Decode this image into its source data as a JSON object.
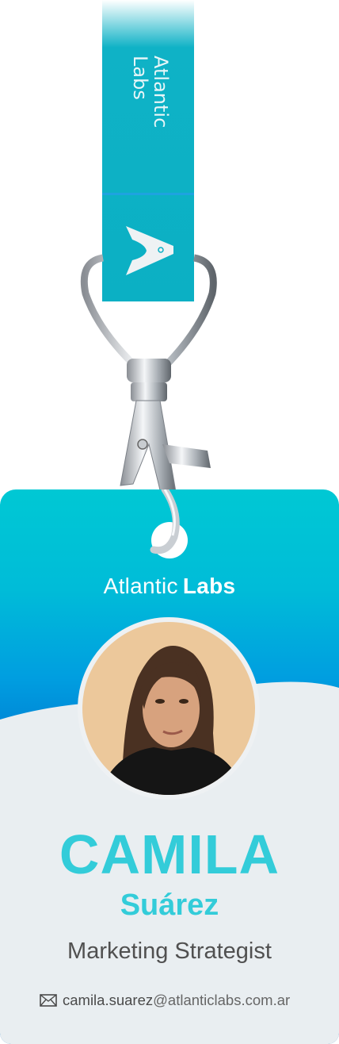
{
  "lanyard": {
    "text_line1": "Atlantic",
    "text_line2": "Labs",
    "logo_icon": "atlantic-labs-rocket-a-logo",
    "color": "#0fb2c6"
  },
  "card": {
    "brand": {
      "part1": "Atlantic",
      "part2": "Labs"
    },
    "first_name": "CAMILA",
    "last_name": "Suárez",
    "role": "Marketing Strategist",
    "email": {
      "icon": "envelope-icon",
      "user": "camila.suarez",
      "domain": "@atlanticlabs.com.ar"
    },
    "colors": {
      "gradient_top": "#00c8d4",
      "gradient_bottom": "#0063b2",
      "name": "#33ccd9",
      "panel": "#e9eef1"
    }
  }
}
